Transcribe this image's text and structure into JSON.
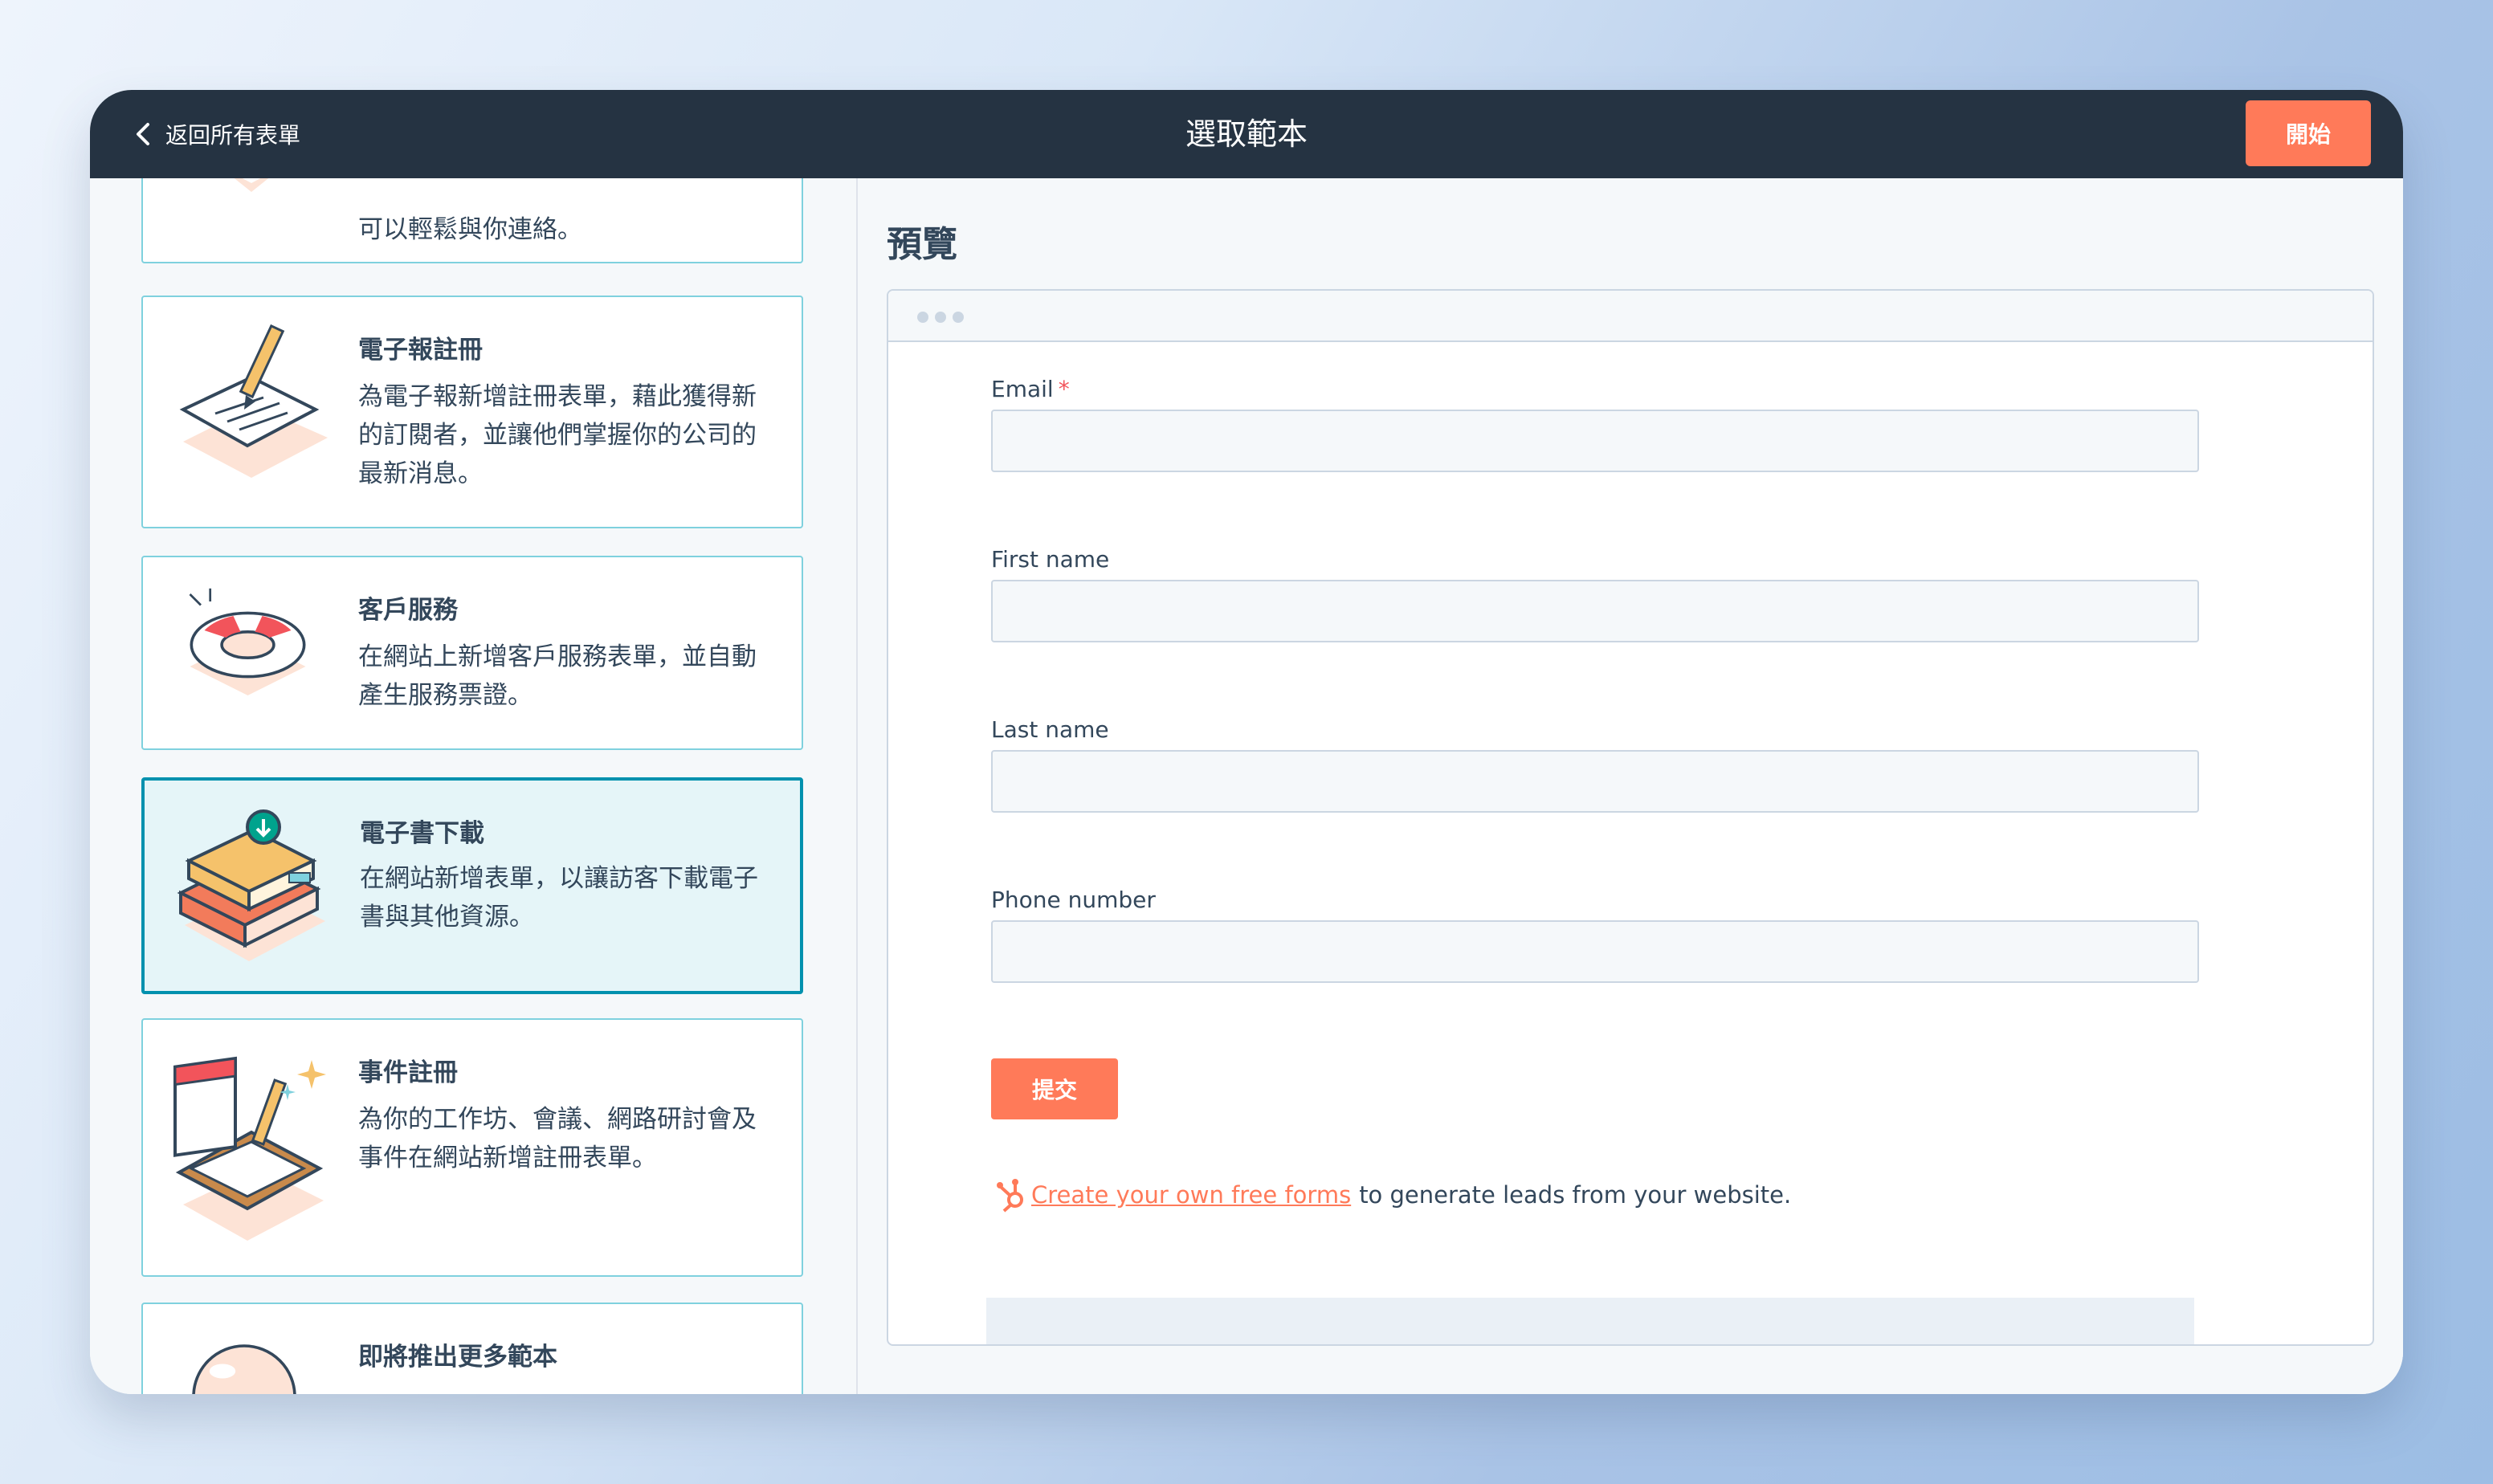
{
  "header": {
    "back_label": "返回所有表單",
    "title": "選取範本",
    "start_label": "開始"
  },
  "templates": [
    {
      "title": "",
      "description": "可以輕鬆與你連絡。",
      "icon": "envelope-illustration"
    },
    {
      "title": "電子報註冊",
      "description": "為電子報新增註冊表單，藉此獲得新的訂閱者，並讓他們掌握你的公司的最新消息。",
      "icon": "newsletter-pen-illustration"
    },
    {
      "title": "客戶服務",
      "description": "在網站上新增客戶服務表單，並自動產生服務票證。",
      "icon": "lifebuoy-illustration"
    },
    {
      "title": "電子書下載",
      "description": "在網站新增表單，以讓訪客下載電子書與其他資源。",
      "icon": "books-download-illustration"
    },
    {
      "title": "事件註冊",
      "description": "為你的工作坊、會議、網路研討會及事件在網站新增註冊表單。",
      "icon": "calendar-clipboard-illustration"
    },
    {
      "title": "即將推出更多範本",
      "description": "",
      "icon": "crystal-ball-illustration"
    }
  ],
  "preview": {
    "label": "預覽",
    "fields": [
      {
        "label": "Email",
        "required_mark": "*",
        "value": ""
      },
      {
        "label": "First name",
        "value": ""
      },
      {
        "label": "Last name",
        "value": ""
      },
      {
        "label": "Phone number",
        "value": ""
      }
    ],
    "submit_label": "提交",
    "promo_link": "Create your own free forms",
    "promo_text": "to generate leads from your website."
  },
  "colors": {
    "topbar": "#253342",
    "accent": "#ff7a59",
    "active_border": "#0091ae",
    "active_bg": "#e5f5f8"
  }
}
